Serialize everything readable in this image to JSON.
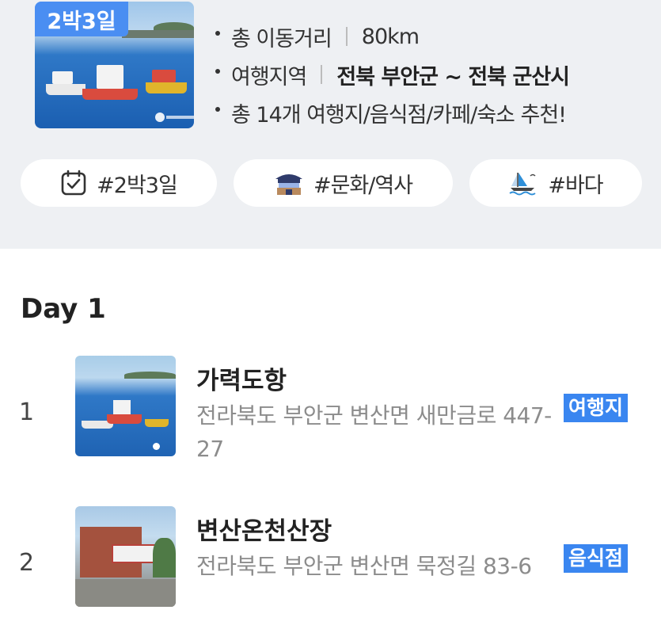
{
  "summary": {
    "badge": "2박3일",
    "distance_label": "총 이동거리",
    "distance_value": "80km",
    "region_label": "여행지역",
    "region_value": "전북 부안군 ~ 전북 군산시",
    "recommend": "총 14개 여행지/음식점/카페/숙소 추천!"
  },
  "tags": [
    {
      "label": "#2박3일",
      "icon": "calendar-check-icon"
    },
    {
      "label": "#문화/역사",
      "icon": "palace-icon"
    },
    {
      "label": "#바다",
      "icon": "sailboat-icon"
    }
  ],
  "day": {
    "title": "Day 1",
    "places": [
      {
        "num": "1",
        "name": "가력도항",
        "address": "전라북도 부안군 변산면 새만금로 447-27",
        "category": "여행지"
      },
      {
        "num": "2",
        "name": "변산온천산장",
        "address": "전라북도 부안군 변산면 묵정길 83-6",
        "category": "음식점"
      }
    ]
  },
  "colors": {
    "accent": "#3a86f0",
    "summary_bg": "#eef0f3",
    "tag_bg": "#ffffff"
  }
}
